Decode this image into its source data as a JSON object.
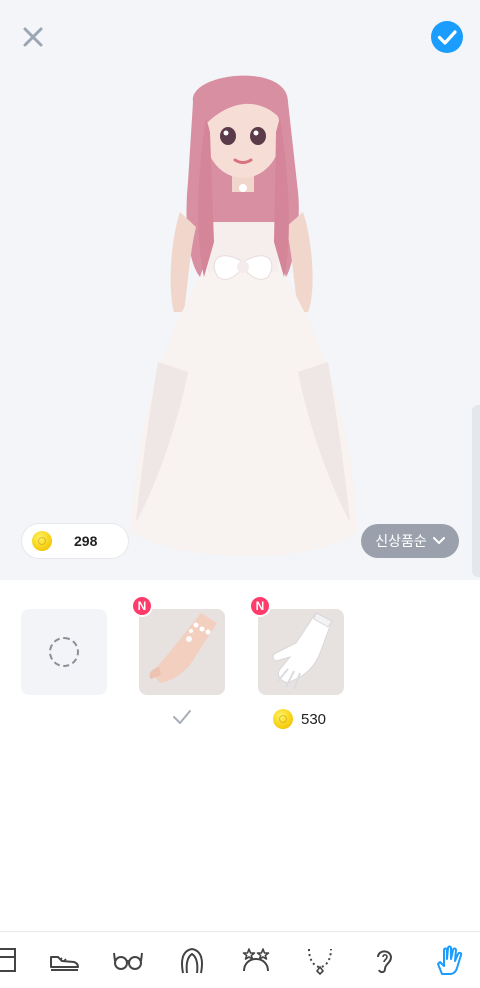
{
  "header": {
    "close_icon": "close-icon",
    "confirm_icon": "check-circle-icon"
  },
  "wallet": {
    "coins": "298"
  },
  "sort": {
    "label": "신상품순",
    "icon": "chevron-down-icon"
  },
  "items": [
    {
      "name": "none",
      "icon": "dashed-circle-icon",
      "selected": false
    },
    {
      "name": "bracelet",
      "badge": "N",
      "selected": true
    },
    {
      "name": "white-gloves",
      "badge": "N",
      "price": "530"
    }
  ],
  "tabs": [
    {
      "name": "clothes-tab",
      "icon": "clothing-icon"
    },
    {
      "name": "shoes-tab",
      "icon": "shoe-icon"
    },
    {
      "name": "glasses-tab",
      "icon": "glasses-icon"
    },
    {
      "name": "hair-tab",
      "icon": "hair-icon"
    },
    {
      "name": "headwear-tab",
      "icon": "headband-icon"
    },
    {
      "name": "necklace-tab",
      "icon": "necklace-icon"
    },
    {
      "name": "earring-tab",
      "icon": "ear-icon"
    },
    {
      "name": "gloves-tab",
      "icon": "hand-icon",
      "active": true
    }
  ],
  "colors": {
    "accent": "#1a9dff",
    "badge": "#ff3b6b",
    "sort_bg": "#9aa1ac",
    "preview_bg": "#f3f5f8"
  }
}
